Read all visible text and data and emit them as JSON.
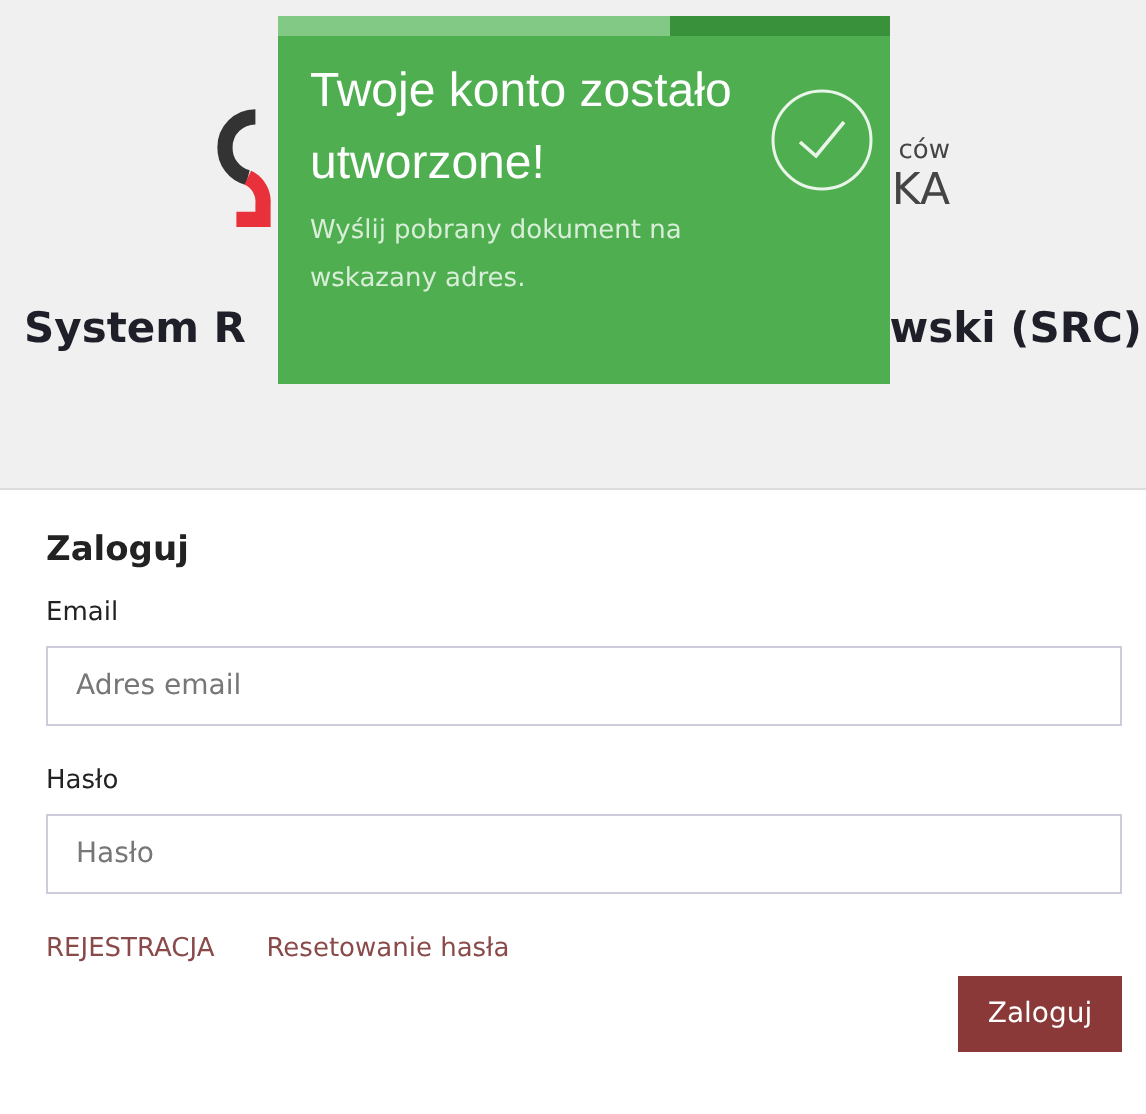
{
  "header": {
    "logo_text": [
      "ców",
      "KA"
    ],
    "title_parts": [
      "System R",
      "wski (SRC)"
    ]
  },
  "toast": {
    "title": "Twoje konto zostało utworzone!",
    "message": "Wyślij pobrany dokument na wskazany adres.",
    "level": 0.64
  },
  "login": {
    "heading": "Zaloguj",
    "fields": [
      {
        "label": "Email",
        "placeholder": "Adres email"
      },
      {
        "label": "Hasło",
        "placeholder": "Hasło"
      }
    ],
    "links": [
      "REJESTRACJA",
      "Resetowanie hasła"
    ],
    "submit": "Zaloguj"
  }
}
